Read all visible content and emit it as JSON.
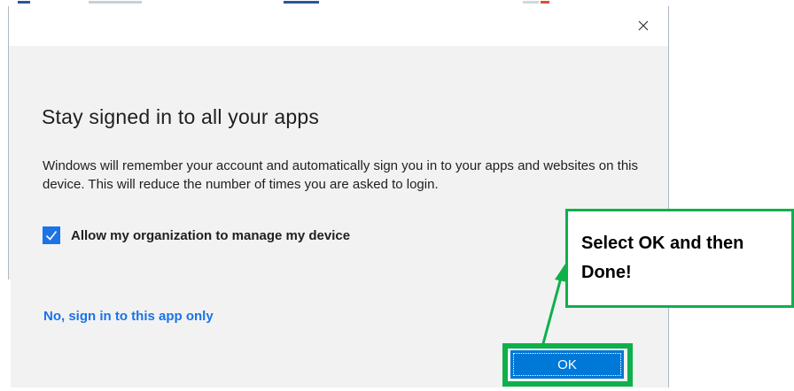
{
  "dialog": {
    "close_symbol": "×",
    "title": "Stay signed in to all your apps",
    "description": "Windows will remember your account and automatically sign you in to your apps and websites on this device. This will reduce the number of times you are asked to login.",
    "checkbox": {
      "label": "Allow my organization to manage my device",
      "checked": true
    },
    "link_label": "No, sign in to this app only",
    "ok_label": "OK"
  },
  "callout": {
    "text": "Select OK and then Done!"
  },
  "colors": {
    "accent": "#0078d7",
    "link": "#1a73e8",
    "highlight": "#0fb04b",
    "dialog_bg": "#f2f2f2"
  },
  "icons": {
    "close": "close-icon",
    "check": "checkmark-icon",
    "arrow": "arrow-icon"
  }
}
